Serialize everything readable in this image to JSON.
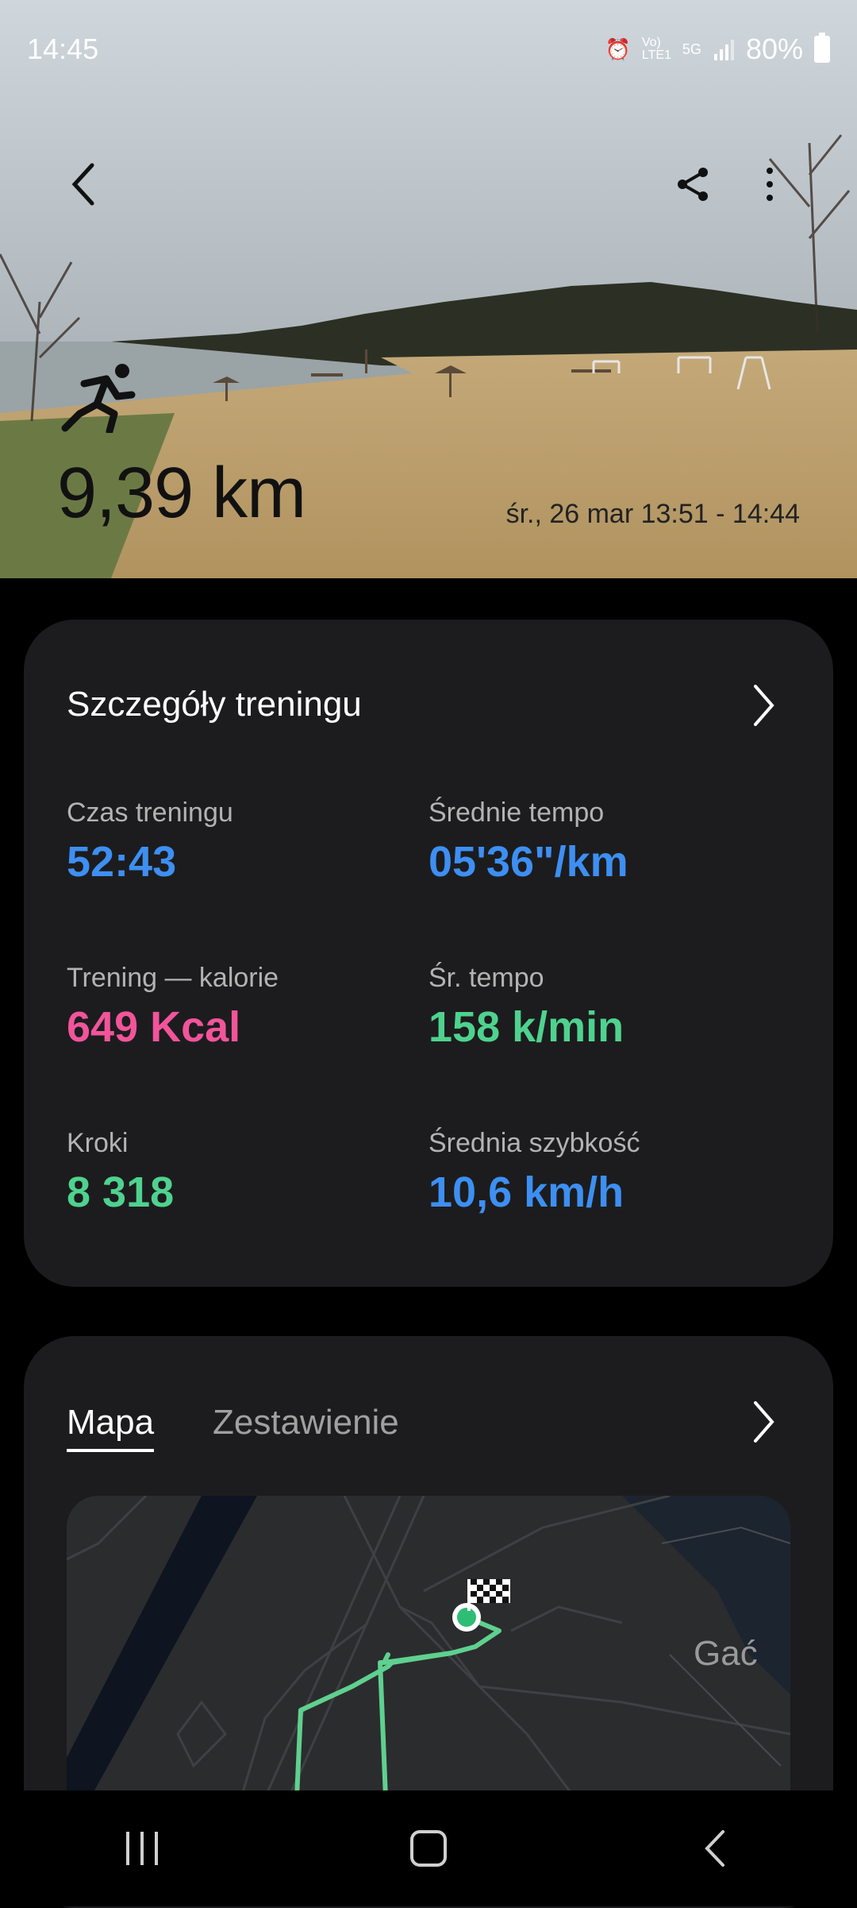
{
  "status_bar": {
    "time": "14:45",
    "battery": "80%",
    "icons": [
      "alarm-icon",
      "volte-icon",
      "5g-icon",
      "signal-icon",
      "battery-icon"
    ]
  },
  "hero": {
    "distance": "9,39 km",
    "datetime": "śr., 26 mar 13:51 - 14:44",
    "activity_icon": "running-icon"
  },
  "details": {
    "title": "Szczegóły treningu",
    "stats": [
      {
        "label": "Czas treningu",
        "value": "52:43",
        "color": "#3d8ff2"
      },
      {
        "label": "Średnie tempo",
        "value": "05'36\"/km",
        "color": "#3d8ff2"
      },
      {
        "label": "Trening — kalorie",
        "value": "649 Kcal",
        "color": "#f2549a"
      },
      {
        "label": "Śr. tempo",
        "value": "158 k/min",
        "color": "#4fd28e"
      },
      {
        "label": "Kroki",
        "value": "8 318",
        "color": "#4fd28e"
      },
      {
        "label": "Średnia szybkość",
        "value": "10,6 km/h",
        "color": "#3d8ff2"
      }
    ]
  },
  "map_card": {
    "tabs": [
      {
        "label": "Mapa",
        "active": true
      },
      {
        "label": "Zestawienie",
        "active": false
      }
    ],
    "map_place_label": "Gać",
    "route_color": "#5fd08f"
  },
  "colors": {
    "background": "#000000",
    "card": "#1c1c1e",
    "accent_blue": "#3d8ff2"
  }
}
